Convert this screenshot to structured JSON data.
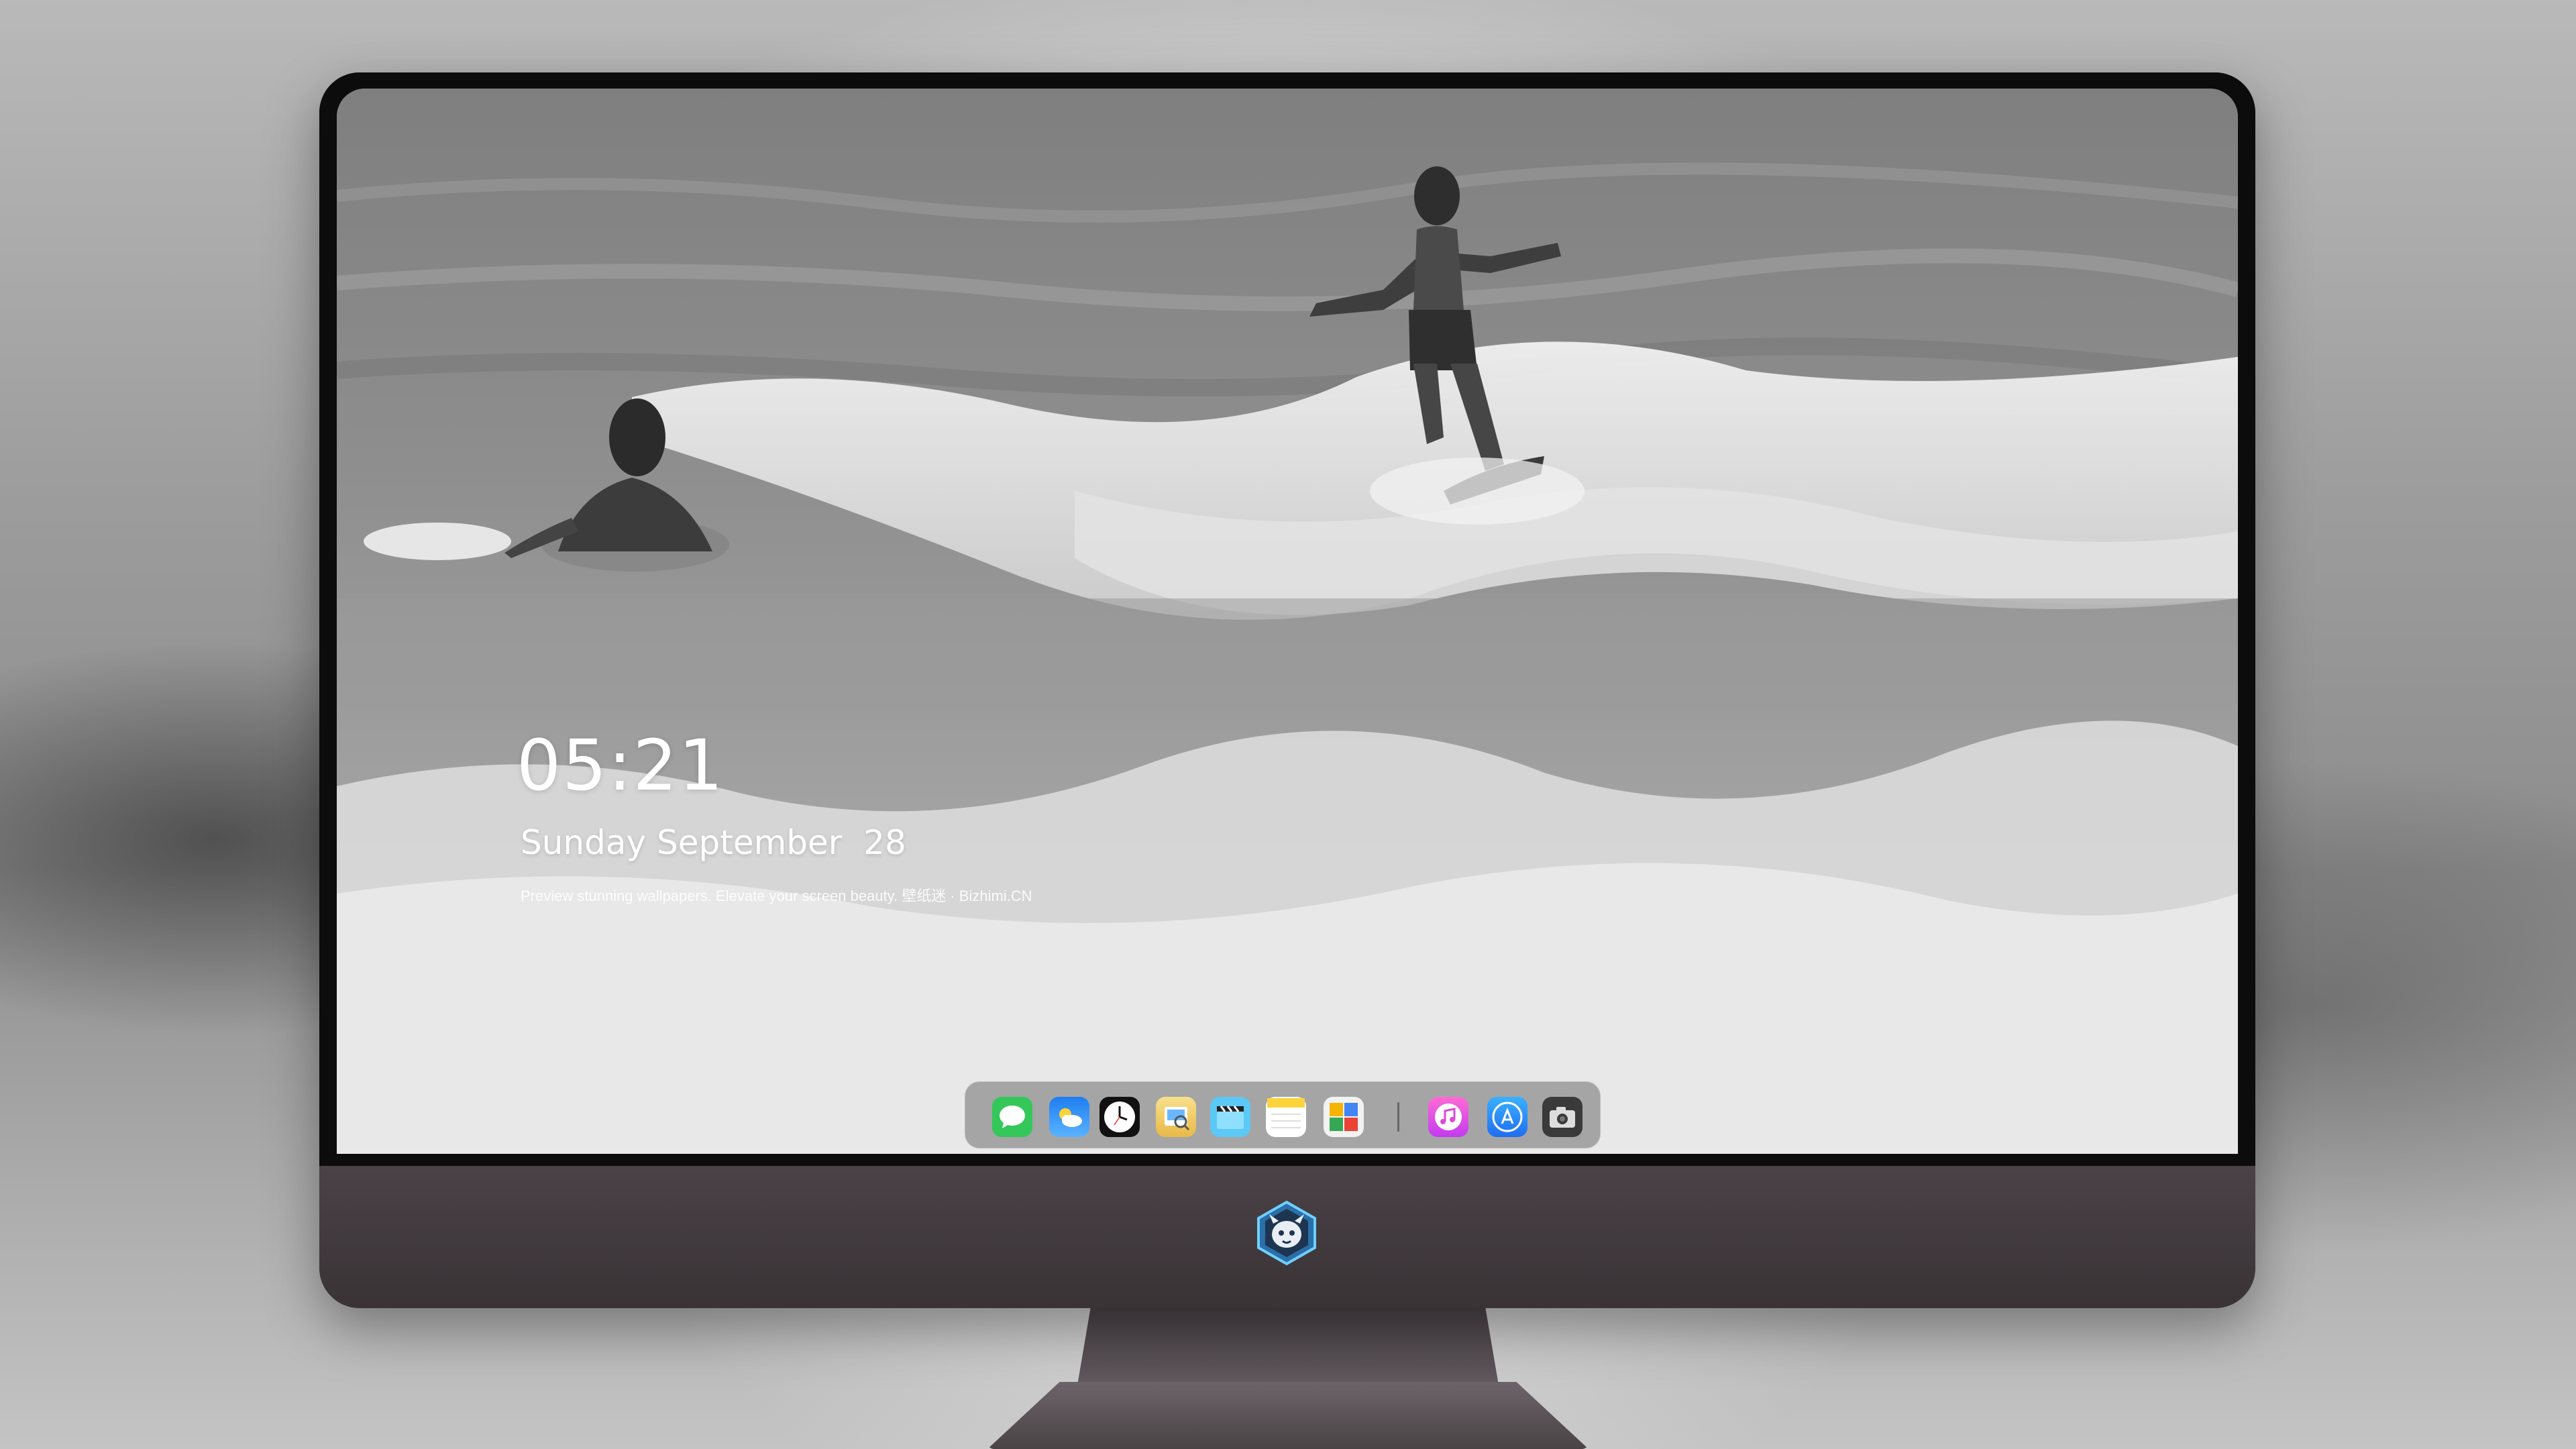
{
  "lockscreen": {
    "time": "05:21",
    "date": "Sunday September  28",
    "tagline": "Preview stunning wallpapers. Elevate your screen beauty. 壁纸迷 · Bizhimi.CN"
  },
  "dock": {
    "apps": [
      {
        "name": "Messages",
        "icon": "messages-icon",
        "color": "#34c759"
      },
      {
        "name": "Weather",
        "icon": "weather-icon",
        "color": "#2f8cf0"
      },
      {
        "name": "Clock",
        "icon": "clock-icon",
        "color": "#111111"
      },
      {
        "name": "Preview",
        "icon": "preview-icon",
        "color": "#e9b949"
      },
      {
        "name": "Clips",
        "icon": "clips-icon",
        "color": "#5bc8f5"
      },
      {
        "name": "Notes",
        "icon": "notes-icon",
        "color": "#fcd33b"
      },
      {
        "name": "Photo Booth",
        "icon": "photo-booth-icon",
        "color": "#ffffff"
      },
      {
        "name": "iTunes",
        "icon": "music-icon",
        "color": "#f45ad7"
      },
      {
        "name": "App Store",
        "icon": "app-store-icon",
        "color": "#1f8ef1"
      },
      {
        "name": "Camera",
        "icon": "camera-icon",
        "color": "#3a3a3a"
      }
    ]
  },
  "monitor": {
    "logo": "robot-mascot-logo",
    "bezel_color": "#0c0c0c",
    "chin_color": "#3b3436"
  }
}
